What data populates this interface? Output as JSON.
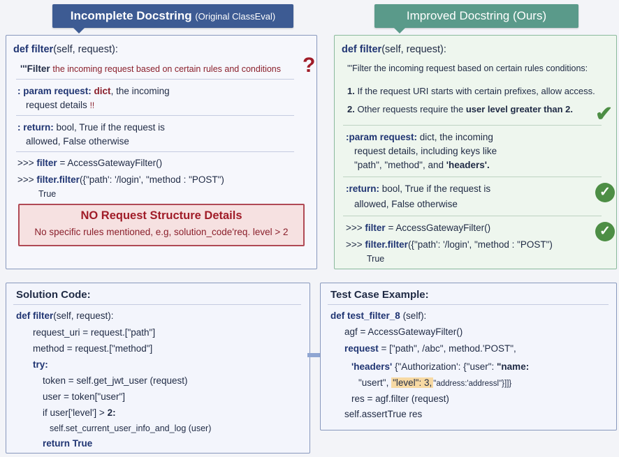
{
  "headers": {
    "left_main": "Incomplete Docstring",
    "left_sub": "(Original ClassEval)",
    "right": "Improved Docstring (Ours)"
  },
  "incomplete": {
    "signature_kw": "def filter",
    "signature_rest": "(self, request):",
    "doc_start": "'''Filter",
    "doc_rest": "the incoming request based on certain rules and conditions",
    "qmark": "?",
    "param_kw": ": param request:",
    "param_type": "dict",
    "param_rest": ", the incoming",
    "param_line2": "request details",
    "param_bang": "!!",
    "return_kw": ": return:",
    "return_rest": "bool, True if the request is",
    "return_line2": "allowed, False otherwise",
    "ex1_prompt": ">>>",
    "ex1_kw": "filter",
    "ex1_rest": "= AccessGatewayFilter()",
    "ex2_prompt": ">>>",
    "ex2_kw": "filter.filter",
    "ex2_rest": "({\"path': '/login', \"method : \"POST\")",
    "ex2_out": "True",
    "warn_title": "NO Request Structure Details",
    "warn_text": "No specific rules mentioned, e.g, solution_code'req. level > 2"
  },
  "improved": {
    "signature_kw": "def filter",
    "signature_rest": "(self, request):",
    "doc": "'''Filter the incoming request based on certain rules conditions:",
    "rule1_num": "1.",
    "rule1": "If the request URI starts with certain prefixes, allow access.",
    "rule2_num": "2.",
    "rule2_a": "Other requests require the",
    "rule2_b": "user level greater than 2.",
    "param_kw": ":param request:",
    "param_rest": "dict, the incoming",
    "param_line2": "request details, including keys like",
    "param_line3_a": "\"path\", \"method\", and",
    "param_line3_b": "'headers'.",
    "return_kw": ":return:",
    "return_rest": "bool, True if the request is",
    "return_line2": "allowed, False otherwise",
    "ex1_prompt": ">>>",
    "ex1_kw": "filter",
    "ex1_rest": "= AccessGatewayFilter()",
    "ex2_prompt": ">>>",
    "ex2_kw": "filter.filter",
    "ex2_rest": "({\"path': '/login', \"method : \"POST\")",
    "ex2_out": "True"
  },
  "solution": {
    "title": "Solution Code:",
    "l1_kw": "def filter",
    "l1_rest": "(self, request):",
    "l2": "request_uri = request.[\"path\"]",
    "l3": "method = request.[\"method\"]",
    "l4": "try:",
    "l5": "token = self.get_jwt_user (request)",
    "l6": "user = token[\"user\"]",
    "l7_a": "if user['level'] >",
    "l7_b": "2:",
    "l8": "self.set_current_user_info_and_log (user)",
    "l9": "return True"
  },
  "test": {
    "title": "Test Case Example:",
    "l1_kw": "def test_filter_8",
    "l1_rest": "(self):",
    "l2": "agf = AccessGatewayFilter()",
    "l3_kw": "request",
    "l3_rest": "= [\"path\", /abc\", method.'POST\",",
    "l4_kw": "'headers'",
    "l4_rest": "{\"Authorization': {\"user\":",
    "l4_end": "\"name:",
    "l5_a": "\"usert\",",
    "l5_hl": "\"level\": 3,",
    "l5_b": "\"address:'addressl\"}]]}",
    "l6": "res = agf.filter (request)",
    "l7": "self.assertTrue res"
  },
  "icons": {
    "question": "question-mark-icon",
    "check": "check-icon",
    "arrow": "arrow-right-icon"
  },
  "colors": {
    "left_header": "#3d5b93",
    "right_header": "#5a9a8a",
    "warning": "#a01c28",
    "check": "#4d8e45",
    "highlight": "#f7d9a3"
  }
}
